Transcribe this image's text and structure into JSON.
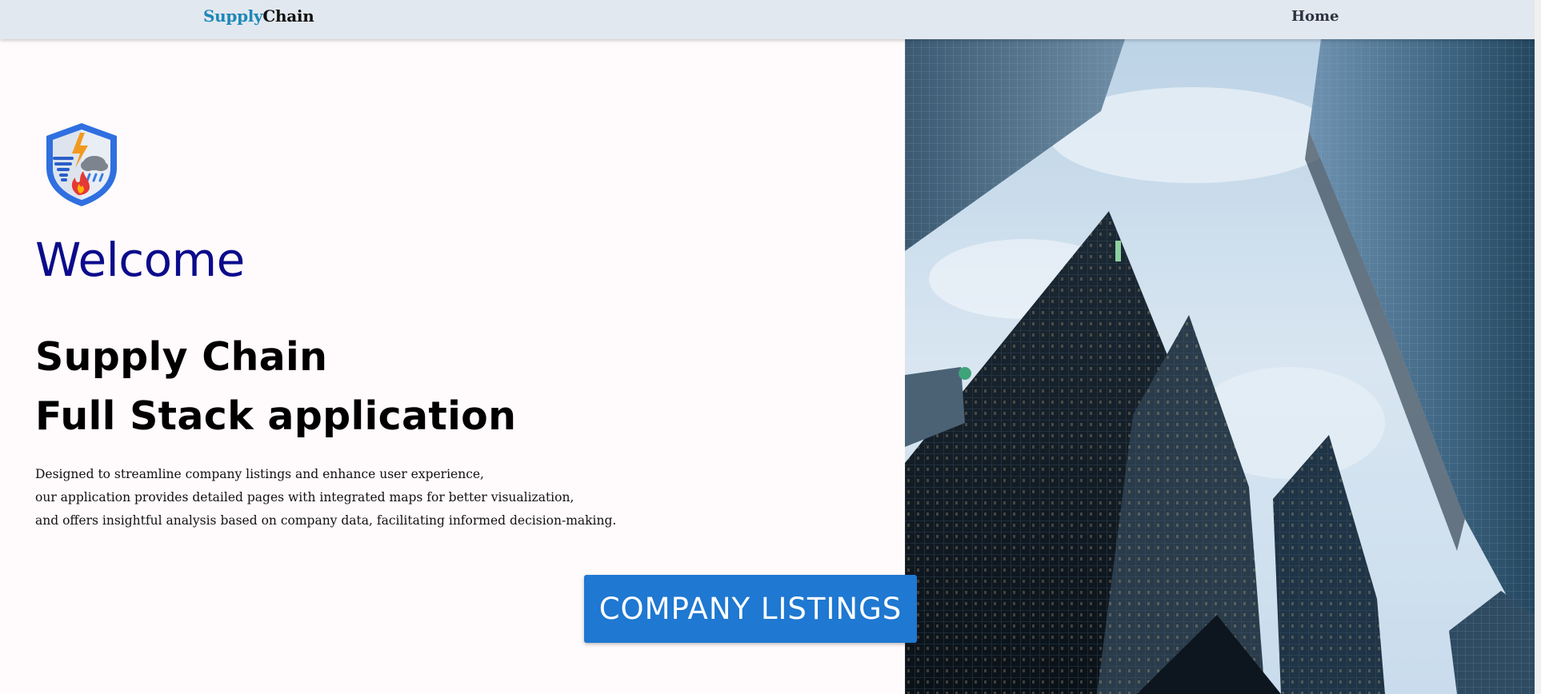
{
  "navbar": {
    "brand_part1": "Supply",
    "brand_part2": "Chain",
    "home_label": "Home"
  },
  "hero": {
    "logo_icon": "shield-weather-hazard-icon",
    "welcome": "Welcome",
    "headline_line1": "Supply Chain",
    "headline_line2": "Full Stack application",
    "description": [
      "Designed to streamline company listings and enhance user experience,",
      "our application provides detailed pages with integrated maps for better visualization,",
      "and offers insightful analysis based on company data, facilitating informed decision-making."
    ],
    "cta_label": "COMPANY LISTINGS"
  },
  "colors": {
    "brand_accent": "#1e88b8",
    "welcome": "#0b0b8c",
    "cta_background": "#1f78d1",
    "navbar_background": "#e2e8f0",
    "page_background": "#fffafb"
  }
}
